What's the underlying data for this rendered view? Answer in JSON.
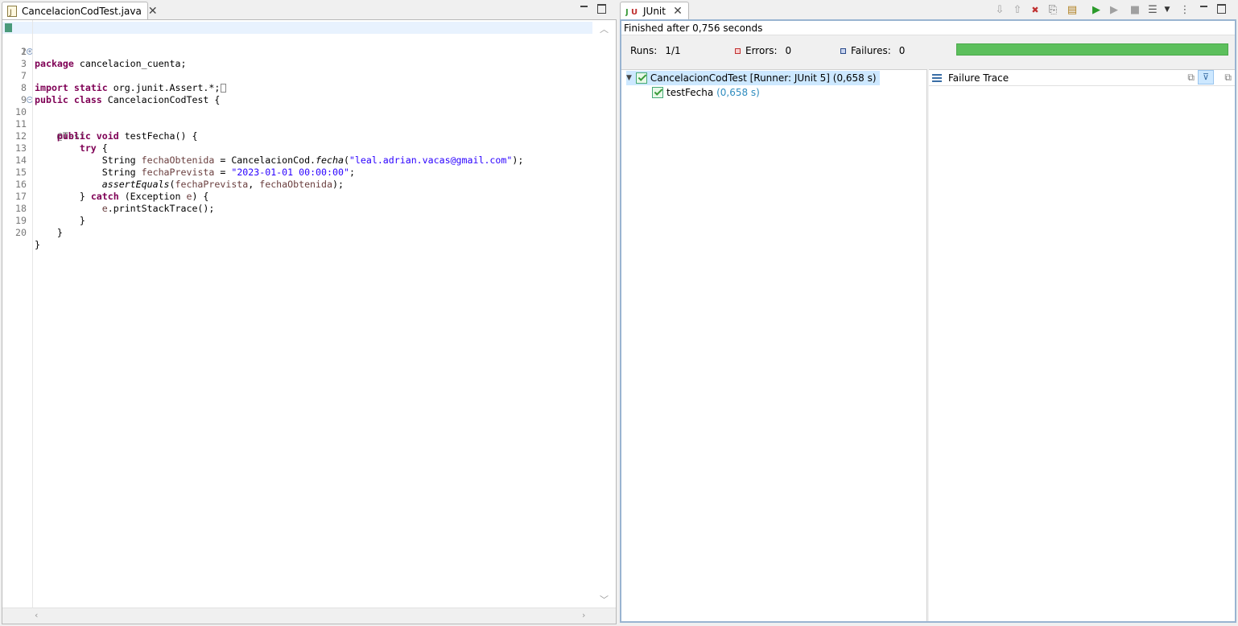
{
  "editor": {
    "tab_label": "CancelacionCodTest.java",
    "lines": [
      {
        "num": "1"
      },
      {
        "num": "2"
      },
      {
        "num": "3"
      },
      {
        "num": "7"
      },
      {
        "num": "8"
      },
      {
        "num": "9"
      },
      {
        "num": "10"
      },
      {
        "num": "11"
      },
      {
        "num": "12"
      },
      {
        "num": "13"
      },
      {
        "num": "14"
      },
      {
        "num": "15"
      },
      {
        "num": "16"
      },
      {
        "num": "17"
      },
      {
        "num": "18"
      },
      {
        "num": "19"
      },
      {
        "num": "20"
      }
    ],
    "code": {
      "l1_kw": "package",
      "l1_rest": " cancelacion_cuenta;",
      "l3_kw1": "import",
      "l3_kw2": "static",
      "l3_rest": " org.junit.Assert.*;",
      "l8_kw1": "public",
      "l8_kw2": "class",
      "l8_rest": " CancelacionCodTest {",
      "l10_ann": "@Test",
      "l11_kw1": "public",
      "l11_kw2": "void",
      "l11_rest": " testFecha() {",
      "l12_kw": "try",
      "l12_rest": " {",
      "l13_type": "String ",
      "l13_var": "fechaObtenida",
      "l13_mid": " = CancelacionCod.",
      "l13_method": "fecha",
      "l13_open": "(",
      "l13_str": "\"leal.adrian.vacas@gmail.com\"",
      "l13_close": ");",
      "l14_type": "String ",
      "l14_var": "fechaPrevista",
      "l14_mid": " = ",
      "l14_str": "\"2023-01-01 00:00:00\"",
      "l14_close": ";",
      "l15_method": "assertEquals",
      "l15_open": "(",
      "l15_var1": "fechaPrevista",
      "l15_comma": ", ",
      "l15_var2": "fechaObtenida",
      "l15_close": ");",
      "l16_open": "} ",
      "l16_kw": "catch",
      "l16_mid": " (Exception ",
      "l16_var": "e",
      "l16_close": ") {",
      "l17_var": "e",
      "l17_rest": ".printStackTrace();",
      "l18": "}",
      "l19": "}",
      "l20": "}"
    }
  },
  "junit": {
    "tab_label": "JUnit",
    "status": "Finished after 0,756 seconds",
    "runs_label": "Runs:",
    "runs_value": "1/1",
    "errors_label": "Errors:",
    "errors_value": "0",
    "failures_label": "Failures:",
    "failures_value": "0",
    "progress": 1.0,
    "progress_color": "#5cbf5c",
    "tree": {
      "root_label": "CancelacionCodTest [Runner: JUnit 5]",
      "root_time": "(0,658 s)",
      "child_label": "testFecha",
      "child_time": "(0,658 s)"
    },
    "trace_title": "Failure Trace"
  }
}
